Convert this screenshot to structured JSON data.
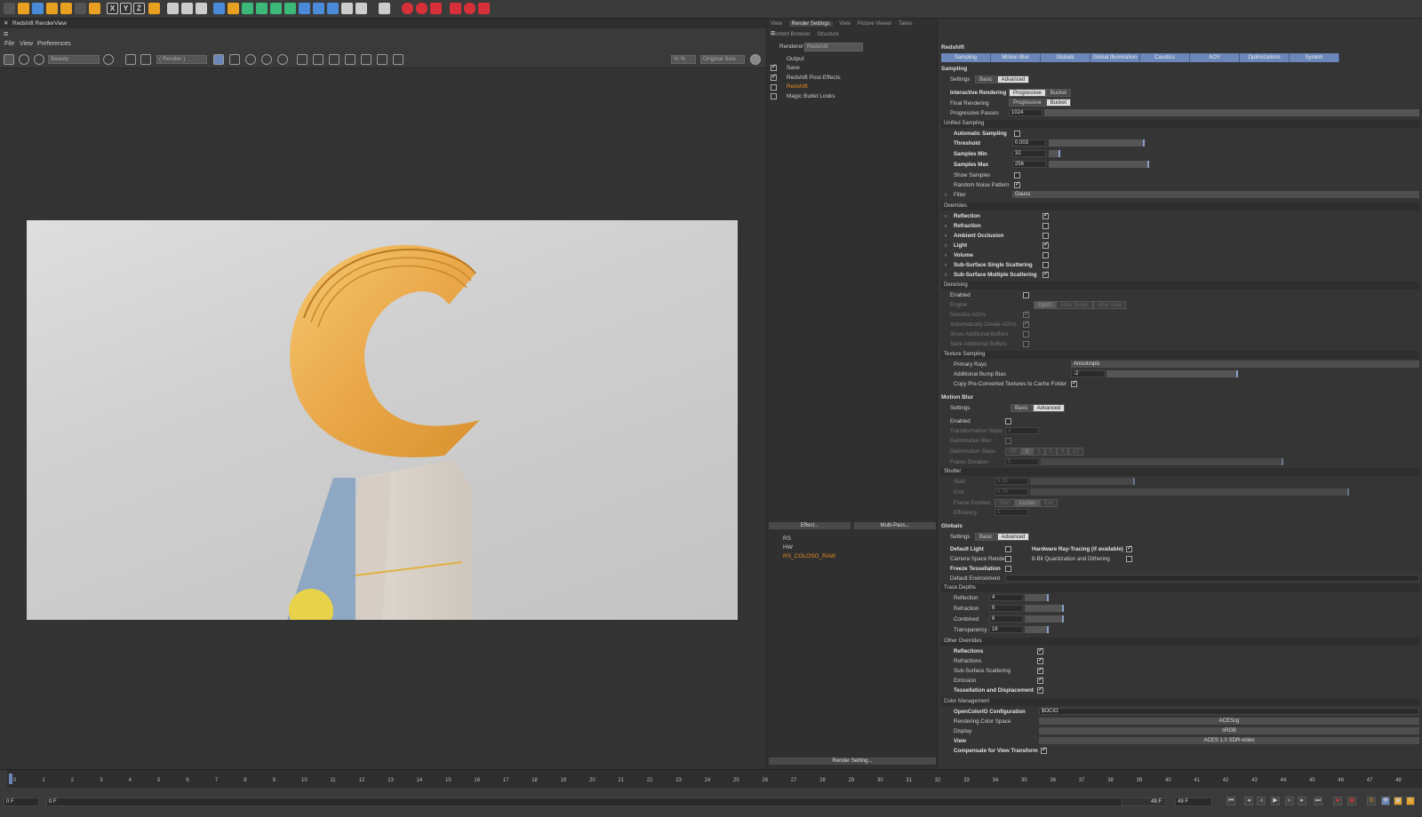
{
  "toolbar": {
    "xyz": [
      "X",
      "Y",
      "Z"
    ],
    "colors": {
      "orange": "#e8a020",
      "blue": "#4a8ad8",
      "green": "#3cb878",
      "red": "#d8303a"
    }
  },
  "renderview": {
    "title": "Redshift RenderView",
    "menu": [
      "File",
      "View",
      "Preferences"
    ],
    "aov_dropdown": "Beauty",
    "render_dropdown": "( Render )",
    "zoom": "% %",
    "size_dropdown": "Original Size"
  },
  "mid": {
    "tabs": [
      "View",
      "Render Settings",
      "View",
      "Picture Viewer",
      "Takes",
      "Content Browser",
      "Structure"
    ],
    "renderer_label": "Renderer",
    "renderer_value": "Redshift",
    "tree": [
      "Output",
      "Save",
      "Redshift Post-Effects",
      "Redshift",
      "Magic Bullet Looks"
    ],
    "effect_button": "Effect...",
    "multipass_button": "Multi-Pass...",
    "passes": [
      "RS",
      "HW",
      "RS_COLOSO_RAW"
    ],
    "render_setting_button": "Render Setting..."
  },
  "right": {
    "title": "Redshift",
    "tabs": [
      "Sampling",
      "Motion Blur",
      "Globals",
      "Global Illumination",
      "Caustics",
      "AOV",
      "Optimizations",
      "System"
    ],
    "sampling": {
      "header": "Sampling",
      "settings_label": "Settings",
      "settings_options": [
        "Basic",
        "Advanced"
      ],
      "interactive_label": "Interactive Rendering",
      "interactive_options": [
        "Progressive",
        "Bucket"
      ],
      "final_label": "Final Rendering",
      "final_options": [
        "Progressive",
        "Bucket"
      ],
      "passes_label": "Progressive Passes",
      "passes_value": "1024",
      "unified": "Unified Sampling",
      "auto_label": "Automatic Sampling",
      "threshold_label": "Threshold",
      "threshold_value": "0.003",
      "threshold_level": 0.26,
      "smin_label": "Samples Min",
      "smin_value": "32",
      "smin_level": 0.03,
      "smax_label": "Samples Max",
      "smax_value": "256",
      "smax_level": 0.27,
      "show_samples": "Show Samples",
      "random_noise": "Random Noise Pattern",
      "filter_label": "Filter",
      "filter_value": "Gauss"
    },
    "overrides": {
      "header": "Overrides",
      "items": [
        {
          "label": "Reflection",
          "checked": true
        },
        {
          "label": "Refraction",
          "checked": false
        },
        {
          "label": "Ambient Occlusion",
          "checked": false
        },
        {
          "label": "Light",
          "checked": true
        },
        {
          "label": "Volume",
          "checked": false
        },
        {
          "label": "Sub-Surface Single Scattering",
          "checked": false
        },
        {
          "label": "Sub-Surface Multiple Scattering",
          "checked": true
        }
      ]
    },
    "denoising": {
      "header": "Denoising",
      "enabled": "Enabled",
      "engine": "Engine",
      "engine_options": [
        "OptiX",
        "Altus Single",
        "Altus Dual"
      ],
      "items": [
        "Denoise AOVs",
        "Automatically Create AOVs",
        "Show Additional Buffers",
        "Save Additional Buffers"
      ]
    },
    "texture": {
      "header": "Texture Sampling",
      "primary_label": "Primary Rays",
      "primary_value": "Anisotropic",
      "bump_label": "Additional Bump Bias",
      "bump_value": "-2",
      "bump_level": 0.42,
      "copy_label": "Copy Pre-Converted Textures to Cache Folder"
    },
    "motion": {
      "header": "Motion Blur",
      "settings_label": "Settings",
      "settings_options": [
        "Basic",
        "Advanced"
      ],
      "enabled": "Enabled",
      "trans_label": "Transformation Steps",
      "trans_value": "2",
      "deform_blur": "Deformation Blur",
      "deform_steps": "Deformation Steps",
      "deform_options": [
        "Off",
        "2",
        "3",
        "5",
        "9",
        "17"
      ],
      "frame_duration": "Frame Duration",
      "frame_duration_value": "1",
      "frame_duration_level": 0.64,
      "shutter": "Shutter",
      "start_label": "Start",
      "start_value": "0.25",
      "start_level": 0.27,
      "end_label": "End",
      "end_value": "0.75",
      "end_level": 0.82,
      "position_label": "Frame Position",
      "position_options": [
        "Start",
        "Center",
        "End"
      ],
      "efficiency_label": "Efficiency",
      "efficiency_value": "1"
    },
    "globals": {
      "header": "Globals",
      "settings_label": "Settings",
      "settings_options": [
        "Basic",
        "Advanced"
      ],
      "default_light": "Default Light",
      "hw_rt": "Hardware Ray-Tracing (if available)",
      "camera_space": "Camera Space Render",
      "bit8": "8-Bit Quantization and Dithering",
      "freeze": "Freeze Tessellation",
      "default_env": "Default Environment",
      "trace": "Trace Depths",
      "depths": [
        {
          "label": "Reflection",
          "value": "4",
          "level": 0.06
        },
        {
          "label": "Refraction",
          "value": "6",
          "level": 0.1
        },
        {
          "label": "Combined",
          "value": "6",
          "level": 0.1
        },
        {
          "label": "Transparency",
          "value": "16",
          "level": 0.06
        }
      ],
      "other": "Other Overrides",
      "other_items": [
        {
          "label": "Reflections",
          "bold": true
        },
        {
          "label": "Refractions",
          "bold": false
        },
        {
          "label": "Sub-Surface Scattering",
          "bold": false
        },
        {
          "label": "Emission",
          "bold": false
        },
        {
          "label": "Tessellation and Displacement",
          "bold": true
        }
      ],
      "color_mgmt": "Color Management",
      "ocio_label": "OpenColorIO Configuration",
      "ocio_value": "$OCIO",
      "space_label": "Rendering Color Space",
      "space_value": "ACEScg",
      "display_label": "Display",
      "display_value": "sRGB",
      "view_label": "View",
      "view_value": "ACES 1.0 SDR-video",
      "compensate": "Compensate for View Transform"
    }
  },
  "timeline": {
    "frames": [
      "0",
      "1",
      "2",
      "3",
      "4",
      "5",
      "6",
      "7",
      "8",
      "9",
      "10",
      "11",
      "12",
      "13",
      "14",
      "15",
      "16",
      "17",
      "18",
      "19",
      "20",
      "21",
      "22",
      "23",
      "24",
      "25",
      "26",
      "27",
      "28",
      "29",
      "30",
      "31",
      "32",
      "33",
      "34",
      "35",
      "36",
      "37",
      "38",
      "39",
      "40",
      "41",
      "42",
      "43",
      "44",
      "45",
      "46",
      "47",
      "48"
    ],
    "start_field": "0 F",
    "current_field": "0 F",
    "end_field": "49 F",
    "end_field2": "49 F"
  }
}
